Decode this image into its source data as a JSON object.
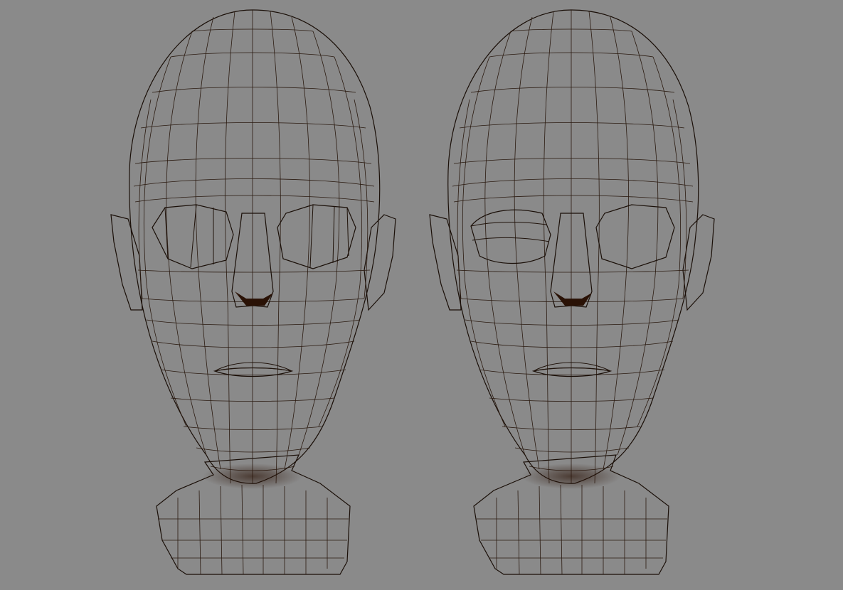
{
  "viewport": {
    "background_color": "#8a8a8a",
    "material_color": "#b56a35",
    "wire_color": "#1f120a",
    "models": [
      {
        "name": "head-model-left",
        "eyes": "open-both"
      },
      {
        "name": "head-model-right",
        "eyes": "left-closed"
      }
    ]
  }
}
